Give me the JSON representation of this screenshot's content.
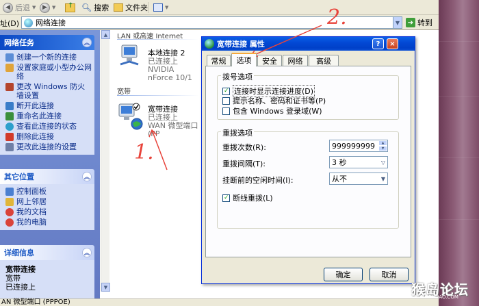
{
  "toolbar": {
    "back_label": "后退",
    "search_label": "搜索",
    "folders_label": "文件夹"
  },
  "address": {
    "label": "址(D)",
    "value": "网络连接",
    "go_label": "转到"
  },
  "tasks": {
    "network": {
      "title": "网络任务",
      "items": [
        {
          "label": "创建一个新的连接",
          "icon": "new-connection-icon"
        },
        {
          "label": "设置家庭或小型办公网络",
          "icon": "home-network-icon"
        },
        {
          "label": "更改 Windows 防火墙设置",
          "icon": "firewall-icon"
        },
        {
          "label": "断开此连接",
          "icon": "disconnect-icon"
        },
        {
          "label": "重命名此连接",
          "icon": "rename-icon"
        },
        {
          "label": "查看此连接的状态",
          "icon": "status-icon"
        },
        {
          "label": "删除此连接",
          "icon": "delete-icon"
        },
        {
          "label": "更改此连接的设置",
          "icon": "settings-icon"
        }
      ]
    },
    "other": {
      "title": "其它位置",
      "items": [
        {
          "label": "控制面板",
          "icon": "control-panel-icon"
        },
        {
          "label": "网上邻居",
          "icon": "network-places-icon"
        },
        {
          "label": "我的文档",
          "icon": "my-documents-icon"
        },
        {
          "label": "我的电脑",
          "icon": "my-computer-icon"
        }
      ]
    },
    "details": {
      "title": "详细信息",
      "name": "宽带连接",
      "type": "宽带",
      "status": "已连接上"
    }
  },
  "main": {
    "group_lan": "LAN 或高速 Internet",
    "group_broadband": "宽带",
    "lan_conn": {
      "name": "本地连接 2",
      "status": "已连接上",
      "device": "NVIDIA nForce 10/1"
    },
    "broadband_conn": {
      "name": "宽带连接",
      "status": "已连接上",
      "device": "WAN 微型端口 (PP"
    }
  },
  "statusbar": {
    "text": "AN 微型端口 (PPPOE)"
  },
  "dialog": {
    "title": "宽带连接 属性",
    "help": "?",
    "close": "×",
    "tabs": [
      "常规",
      "选项",
      "安全",
      "网络",
      "高级"
    ],
    "active_tab": "选项",
    "dial_group": "拨号选项",
    "dial_opts": [
      {
        "label": "连接时显示连接进度(D)",
        "checked": true
      },
      {
        "label": "提示名称、密码和证书等(P)",
        "checked": false
      },
      {
        "label": "包含 Windows 登录域(W)",
        "checked": false
      }
    ],
    "redial_group": "重拨选项",
    "redial_attempts_label": "重拨次数(R):",
    "redial_attempts_value": "999999999",
    "redial_interval_label": "重拨间隔(T):",
    "redial_interval_value": "3 秒",
    "idle_label": "挂断前的空闲时间(I):",
    "idle_value": "从不",
    "redial_on_drop": {
      "label": "断线重拨(L)",
      "checked": true
    },
    "ok": "确定",
    "cancel": "取消"
  },
  "annotations": {
    "mark_1": "1.",
    "mark_2": "2."
  },
  "watermark": {
    "text": "猴岛论坛",
    "sub": "BBS.HOUDAO.COM"
  },
  "colors": {
    "task_pane": "#6f89cb",
    "title_bar": "#0349d5",
    "annotation": "#e8433a"
  }
}
